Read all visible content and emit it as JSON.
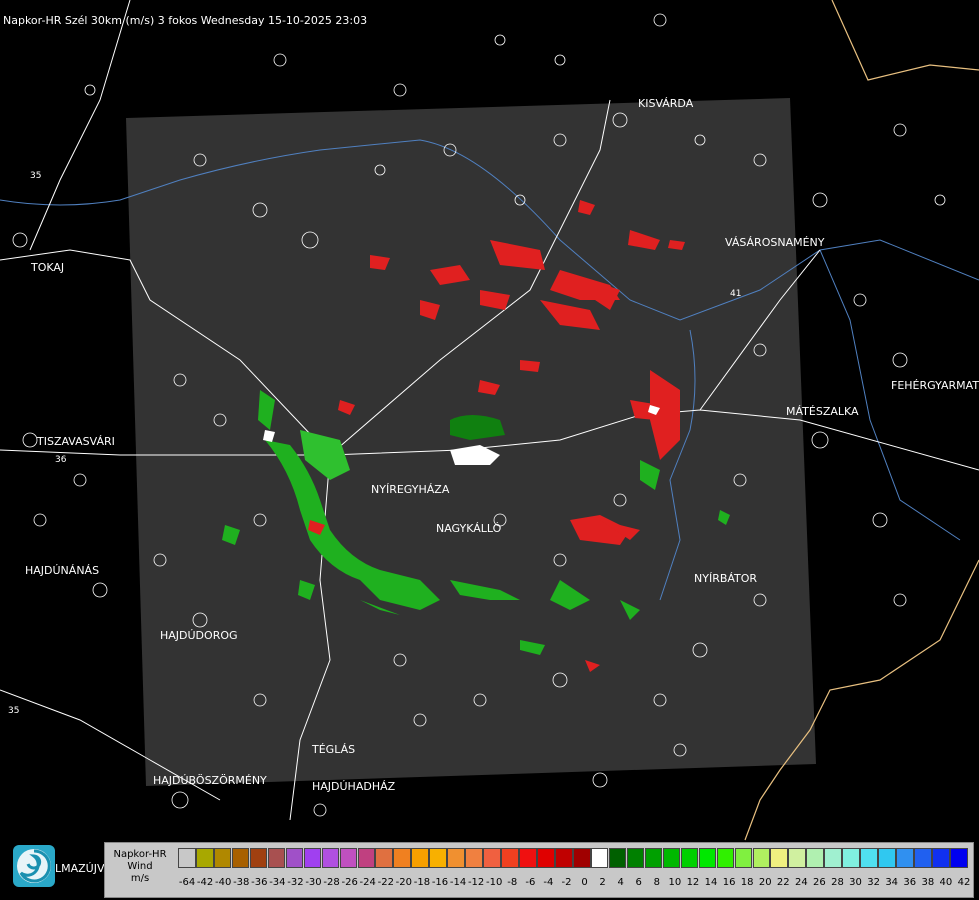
{
  "title": "Napkor-HR Szél 30km (m/s) 3 fokos Wednesday 15-10-2025 23:03",
  "cities": [
    {
      "name": "KISVÁRDA",
      "id": "kisvarda"
    },
    {
      "name": "VÁSÁROSNAMÉNY",
      "id": "vasarosnameny"
    },
    {
      "name": "TOKAJ",
      "id": "tokaj"
    },
    {
      "name": "FEHÉRGYARMAT",
      "id": "fehergyarmat"
    },
    {
      "name": "MÁTÉSZALKA",
      "id": "mateszalka"
    },
    {
      "name": "TISZAVASVÁRI",
      "id": "tiszavasvari"
    },
    {
      "name": "NYÍREGYHÁZA",
      "id": "nyiregyhaza"
    },
    {
      "name": "NAGYKÁLLÓ",
      "id": "nagykallo"
    },
    {
      "name": "HAJDÚNÁNÁS",
      "id": "hajdunanas"
    },
    {
      "name": "NYÍRBÁTOR",
      "id": "nyirbator"
    },
    {
      "name": "HAJDÚDOROG",
      "id": "hajdudorog"
    },
    {
      "name": "TÉGLÁS",
      "id": "teglas"
    },
    {
      "name": "HAJDÚBÖSZÖRMÉNY",
      "id": "hajduboszormeny"
    },
    {
      "name": "HAJDÚHADHÁZ",
      "id": "hajduhadhaz"
    },
    {
      "name": "LMAZÚJVÁR",
      "id": "lmazujvar"
    }
  ],
  "road_numbers": [
    "35",
    "36",
    "41",
    "35"
  ],
  "legend": {
    "line1": "Napkor-HR",
    "line2": "Wind",
    "line3": "m/s",
    "ticks": [
      "-64",
      "-42",
      "-40",
      "-38",
      "-36",
      "-34",
      "-32",
      "-30",
      "-28",
      "-26",
      "-24",
      "-22",
      "-20",
      "-18",
      "-16",
      "-14",
      "-12",
      "-10",
      "-8",
      "-6",
      "-4",
      "-2",
      "0",
      "2",
      "4",
      "6",
      "8",
      "10",
      "12",
      "14",
      "16",
      "18",
      "20",
      "22",
      "24",
      "26",
      "28",
      "30",
      "32",
      "34",
      "36",
      "38",
      "40",
      "42"
    ],
    "colors": [
      "#c8c8c8",
      "#a8a800",
      "#b08800",
      "#a86000",
      "#a04010",
      "#a85050",
      "#a050c8",
      "#a040f0",
      "#b050e0",
      "#c050c0",
      "#c04080",
      "#e07040",
      "#f08020",
      "#f8a000",
      "#f8b000",
      "#f09030",
      "#f08040",
      "#f06040",
      "#f04020",
      "#f01010",
      "#e00000",
      "#c00000",
      "#a00000",
      "#ffffff",
      "#006000",
      "#008000",
      "#00a000",
      "#00b800",
      "#00d000",
      "#00e800",
      "#30f000",
      "#80f040",
      "#b0f060",
      "#f0f080",
      "#d0f0a0",
      "#b0f0b0",
      "#a0f0d0",
      "#80f0e0",
      "#50e0f0",
      "#30c8f0",
      "#3090f0",
      "#2060f0",
      "#1030f0",
      "#0000f0"
    ]
  },
  "colors": {
    "background": "#000000",
    "radar_area": "#333333",
    "borders": "#e8c080",
    "rivers": "#5080c0"
  }
}
